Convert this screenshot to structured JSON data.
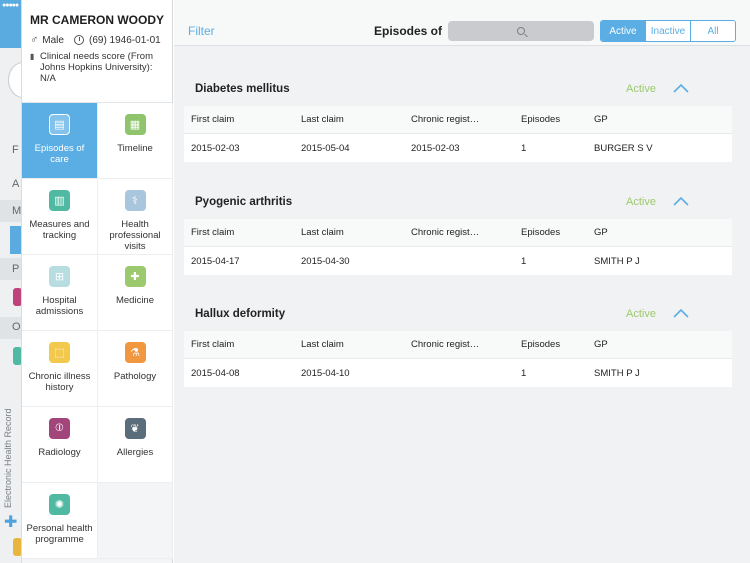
{
  "patient": {
    "name": "MR CAMERON WOODY",
    "gender": "Male",
    "age_dob": "(69) 1946-01-01",
    "clinical_score": "Clinical needs score (From Johns Hopkins University): N/A"
  },
  "sidebar_tab": "Electronic Health Record",
  "menu": [
    {
      "label": "Episodes of care",
      "icon": "episodes-icon",
      "color": "#5aaee3",
      "active": true
    },
    {
      "label": "Timeline",
      "icon": "timeline-icon",
      "color": "#8dc46c",
      "active": false
    },
    {
      "label": "Measures and tracking",
      "icon": "measures-icon",
      "color": "#4fb9a2",
      "active": false
    },
    {
      "label": "Health professional visits",
      "icon": "stethoscope-icon",
      "color": "#a9c6dd",
      "active": false
    },
    {
      "label": "Hospital admissions",
      "icon": "hospital-icon",
      "color": "#b8dde1",
      "active": false
    },
    {
      "label": "Medicine",
      "icon": "medicine-icon",
      "color": "#9cc96e",
      "active": false
    },
    {
      "label": "Chronic illness history",
      "icon": "chronic-icon",
      "color": "#f2c94c",
      "active": false
    },
    {
      "label": "Pathology",
      "icon": "microscope-icon",
      "color": "#f0973f",
      "active": false
    },
    {
      "label": "Radiology",
      "icon": "lungs-icon",
      "color": "#a2457a",
      "active": false
    },
    {
      "label": "Allergies",
      "icon": "wheat-icon",
      "color": "#5a6d7a",
      "active": false
    },
    {
      "label": "Personal health programme",
      "icon": "programme-icon",
      "color": "#4fb9a2",
      "active": false
    }
  ],
  "toolbar": {
    "filter": "Filter",
    "title": "Episodes of",
    "segments": [
      "Active",
      "Inactive",
      "All"
    ],
    "selected_segment": "Active"
  },
  "columns": [
    "First claim",
    "Last claim",
    "Chronic regist…",
    "Episodes",
    "GP"
  ],
  "episodes": [
    {
      "title": "Diabetes mellitus",
      "status": "Active",
      "row": [
        "2015-02-03",
        "2015-05-04",
        "2015-02-03",
        "1",
        "BURGER S V"
      ]
    },
    {
      "title": "Pyogenic arthritis",
      "status": "Active",
      "row": [
        "2015-04-17",
        "2015-04-30",
        "",
        "1",
        "SMITH P J"
      ]
    },
    {
      "title": "Hallux deformity",
      "status": "Active",
      "row": [
        "2015-04-08",
        "2015-04-10",
        "",
        "1",
        "SMITH P J"
      ]
    }
  ],
  "colors": {
    "accent": "#5aaee3",
    "status_active": "#9cc96e"
  }
}
